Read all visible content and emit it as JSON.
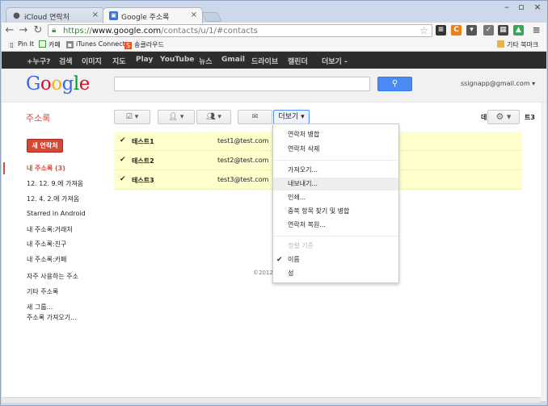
{
  "browser": {
    "tabs": [
      {
        "title": "iCloud 연락처",
        "active": false
      },
      {
        "title": "Google 주소록",
        "active": true
      }
    ],
    "url": {
      "scheme": "https://",
      "host": "www.google.com",
      "path": "/contacts/u/1/#contacts"
    },
    "bookmarks": [
      {
        "label": "Pin It",
        "icon": "pinterest-icon"
      },
      {
        "label": "카페",
        "icon": "cafe-icon"
      },
      {
        "label": "iTunes Connect",
        "icon": "itunes-icon"
      },
      {
        "label": "송클라우드",
        "icon": "cloud-icon"
      }
    ],
    "other_bookmarks": "기타 북마크"
  },
  "gbar": {
    "items": [
      "+누구?",
      "검색",
      "이미지",
      "지도",
      "Play",
      "YouTube",
      "뉴스",
      "Gmail",
      "드라이브",
      "캘린더",
      "더보기 -"
    ]
  },
  "header": {
    "logo": "Google",
    "account": "ssignapp@gmail.com"
  },
  "app": {
    "title": "주소록",
    "new_contact": "새 연락처",
    "more_button": "더보기"
  },
  "nav": {
    "items": [
      {
        "label": "내 주소록 (3)",
        "selected": true
      },
      {
        "label": "12. 12. 9.에 가져옴",
        "selected": false
      },
      {
        "label": "12. 4. 2.에 가져옴",
        "selected": false
      },
      {
        "label": "Starred in Android",
        "selected": false
      },
      {
        "label": "내 주소록:거래처",
        "selected": false
      },
      {
        "label": "내 주소록:친구",
        "selected": false
      },
      {
        "label": "내 주소록:카페",
        "selected": false
      },
      {
        "label": "자주 사용하는 주소",
        "selected": false
      },
      {
        "label": "기타 주소록",
        "selected": false
      },
      {
        "label": "새 그룹...",
        "selected": false
      },
      {
        "label": "주소록 가져오기...",
        "selected": false
      }
    ]
  },
  "contacts": [
    {
      "name": "테스트1",
      "email": "test1@test.com",
      "checked": true
    },
    {
      "name": "테스트2",
      "email": "test2@test.com",
      "checked": true
    },
    {
      "name": "테스트3",
      "email": "test3@test.com",
      "checked": true
    }
  ],
  "partial_labels": {
    "left": "데",
    "right": "트3"
  },
  "copyright": "©2012",
  "menu": {
    "items": [
      {
        "label": "연락처 병합"
      },
      {
        "label": "연락처 삭제"
      },
      {
        "label": "가져오기..."
      },
      {
        "label": "내보내기...",
        "hover": true
      },
      {
        "label": "인쇄..."
      },
      {
        "label": "중복 항목 찾기 및 병합"
      },
      {
        "label": "연락처 복원..."
      },
      {
        "label": "정렬 기준",
        "disabled": true
      },
      {
        "label": "이름",
        "checked": true
      },
      {
        "label": "성"
      }
    ]
  },
  "colors": {
    "accent": "#dd4b39",
    "search_blue": "#4a8af4",
    "selected_row": "#ffffcc"
  }
}
